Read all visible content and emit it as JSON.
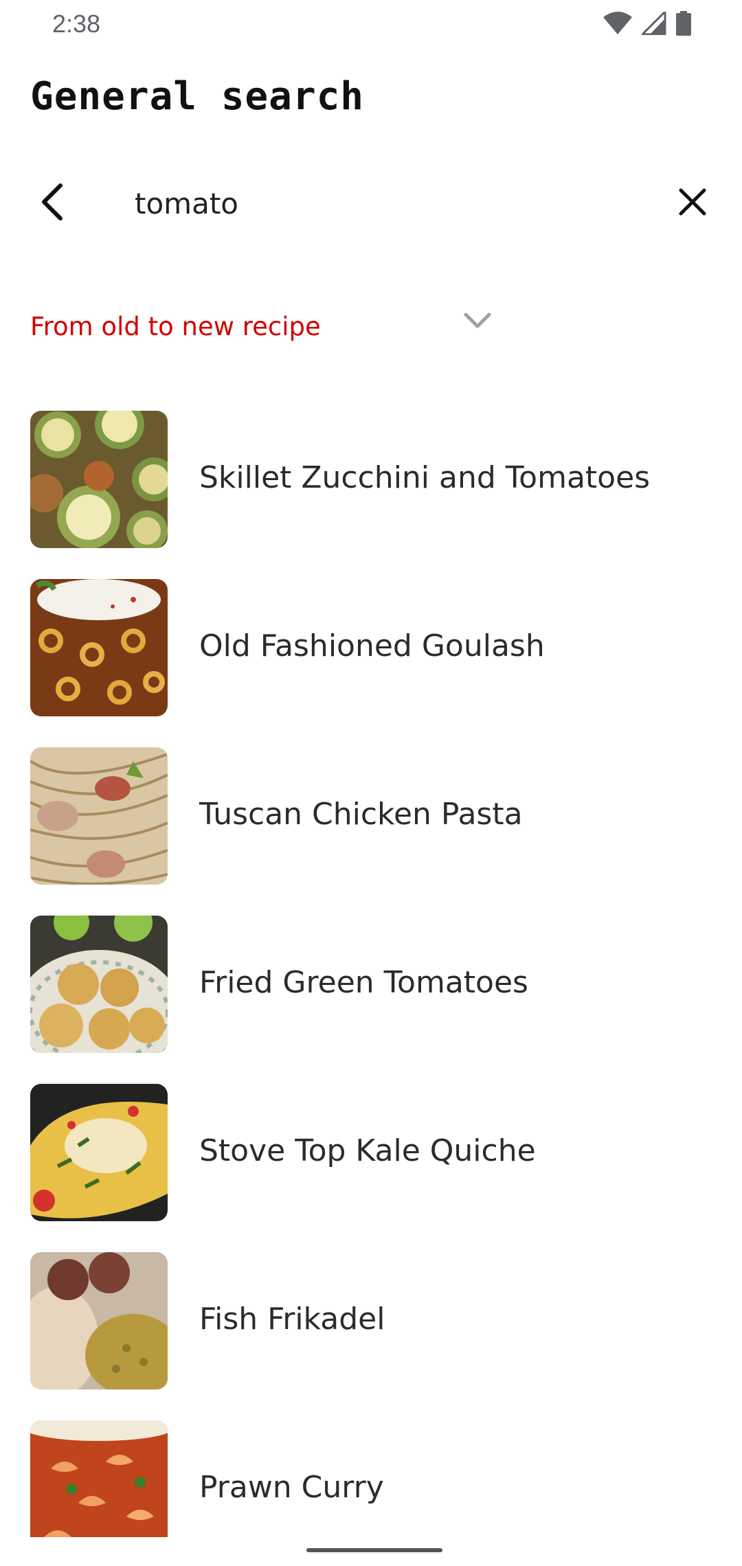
{
  "status_bar": {
    "time": "2:38",
    "icons": [
      "wifi-icon",
      "cell-signal-icon",
      "battery-icon"
    ]
  },
  "page_title": "General search",
  "search": {
    "value": "tomato",
    "back_icon": "chevron-left-icon",
    "clear_icon": "close-icon"
  },
  "sort": {
    "label": "From old to new recipe",
    "color": "#d10000",
    "icon": "chevron-down-icon"
  },
  "recipes": [
    {
      "title": "Skillet Zucchini and Tomatoes",
      "thumb": "zucchini-tomatoes-photo"
    },
    {
      "title": "Old Fashioned Goulash",
      "thumb": "goulash-photo"
    },
    {
      "title": "Tuscan Chicken Pasta",
      "thumb": "chicken-pasta-photo"
    },
    {
      "title": "Fried Green Tomatoes",
      "thumb": "fried-green-tomatoes-photo"
    },
    {
      "title": "Stove Top Kale Quiche",
      "thumb": "kale-quiche-photo"
    },
    {
      "title": "Fish Frikadel",
      "thumb": "fish-frikadel-photo"
    },
    {
      "title": "Prawn Curry",
      "thumb": "prawn-curry-photo"
    }
  ]
}
